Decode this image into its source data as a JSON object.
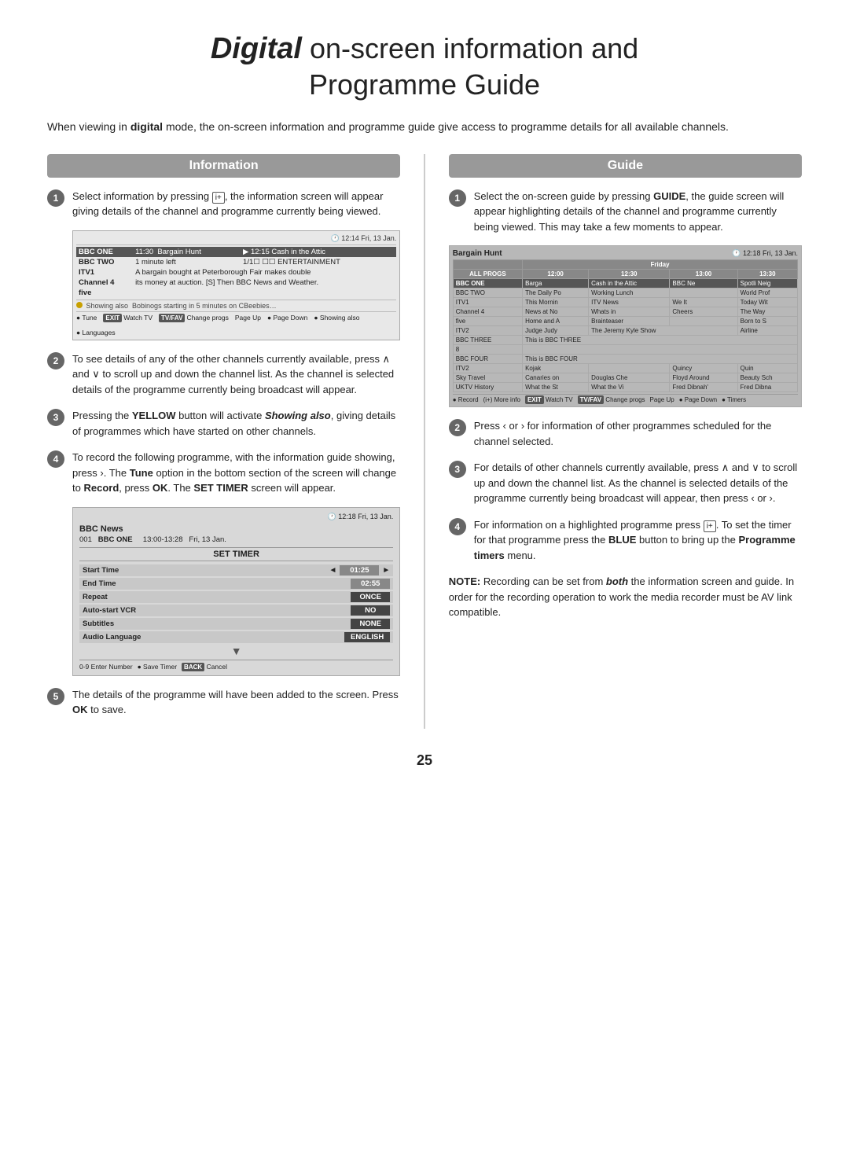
{
  "page": {
    "title_bold": "Digital",
    "title_rest": " on-screen information and",
    "title_line2": "Programme Guide",
    "intro": "When viewing in digital mode, the on-screen information and programme guide give access to programme details for all available channels.",
    "page_number": "25"
  },
  "info_section": {
    "header": "Information",
    "steps": [
      {
        "num": "1",
        "text": "Select information by pressing i+, the information screen will appear giving details of the channel and programme currently being viewed."
      },
      {
        "num": "2",
        "text": "To see details of any of the other channels currently available, press ∧ and ∨ to scroll up and down the channel list. As the channel is selected details of the programme currently being broadcast will appear."
      },
      {
        "num": "3",
        "text": "Pressing the YELLOW button will activate Showing also, giving details of programmes which have started on other channels."
      },
      {
        "num": "4",
        "text": "To record the following programme, with the information guide showing, press ›. The Tune option in the bottom section of the screen will change to Record, press OK. The SET TIMER screen will appear."
      },
      {
        "num": "5",
        "text": "The details of the programme will have been added to the screen. Press OK to save."
      }
    ]
  },
  "guide_section": {
    "header": "Guide",
    "steps": [
      {
        "num": "1",
        "text": "Select the on-screen guide by pressing GUIDE, the guide screen will appear highlighting details of the channel and programme currently being viewed. This may take a few moments to appear."
      },
      {
        "num": "2",
        "text": "Press ‹ or › for information of other programmes scheduled for the channel selected."
      },
      {
        "num": "3",
        "text": "For details of other channels currently available, press ∧ and ∨ to scroll up and down the channel list. As the channel is selected details of the programme currently being broadcast will appear, then press ‹ or ›."
      },
      {
        "num": "4",
        "text": "For information on a highlighted programme press i+. To set the timer for that programme press the BLUE button to bring up the Programme timers menu."
      }
    ],
    "note": "NOTE: Recording can be set from both the information screen and guide. In order for the recording operation to work the media recorder must be AV link compatible."
  },
  "info_screen": {
    "time": "🕐 12:14 Fri, 13 Jan.",
    "channels": [
      {
        "name": "BBC ONE",
        "col1": "11:30  Bargain Hunt",
        "col2": "▶ 12:15 Cash in the Attic",
        "highlight": true
      },
      {
        "name": "BBC TWO",
        "col1": "1 minute left",
        "col2": "1/1☐ ☐☐ ENTERTAINMENT",
        "highlight": false
      },
      {
        "name": "ITV1",
        "col1": "A bargain bought at Peterborough Fair makes double",
        "col2": "",
        "highlight": false
      },
      {
        "name": "Channel 4",
        "col1": "its money at auction. [S] Then BBC News and Weather.",
        "col2": "",
        "highlight": false
      },
      {
        "name": "five",
        "col1": "",
        "col2": "",
        "highlight": false
      }
    ],
    "showing_also": "Showing also  Bobinogs starting in 5 minutes on CBeebies…",
    "bottom_items": [
      "● Tune",
      "EXIT Watch TV",
      "TV/FAV Change progs",
      "Page Up",
      "● Page Down",
      "● Showing also",
      "● Languages"
    ]
  },
  "timer_screen": {
    "time": "🕐 12:18 Fri, 13 Jan.",
    "title": "BBC News",
    "info": "001   BBC ONE      13:00-13:28   Fri, 13 Jan.",
    "set_timer_label": "SET TIMER",
    "rows": [
      {
        "label": "Start Time",
        "value": "01:25",
        "dark": false
      },
      {
        "label": "End Time",
        "value": "02:55",
        "dark": false
      },
      {
        "label": "Repeat",
        "value": "ONCE",
        "dark": true
      },
      {
        "label": "Auto-start VCR",
        "value": "NO",
        "dark": true
      },
      {
        "label": "Subtitles",
        "value": "NONE",
        "dark": true
      },
      {
        "label": "Audio Language",
        "value": "ENGLISH",
        "dark": true
      }
    ],
    "bottom": "0-9 Enter Number  ● Save Timer  BACK Cancel"
  },
  "guide_screen": {
    "title": "Bargain Hunt",
    "time": "🕐 12:18 Fri, 13 Jan.",
    "col_header": "Friday",
    "cols": [
      "ALL PROGS",
      "12:00",
      "12:30",
      "13:00",
      "13:30"
    ],
    "rows": [
      {
        "channel": "BBC ONE",
        "cells": [
          "Barga",
          "Cash in the Attic",
          "BBC Ne",
          "Spotli",
          "Neig"
        ],
        "highlight": true
      },
      {
        "channel": "BBC TWO",
        "cells": [
          "The Daily Po",
          "Working Lunch",
          "",
          "World Prof"
        ],
        "highlight": false
      },
      {
        "channel": "ITV1",
        "cells": [
          "This Mornin",
          "ITV News",
          "",
          "We It",
          "Today Wit"
        ],
        "highlight": false
      },
      {
        "channel": "Channel 4",
        "cells": [
          "News at No",
          "Whats in",
          "Cheers",
          "",
          "The Way"
        ],
        "highlight": false
      },
      {
        "channel": "five",
        "cells": [
          "Home and A",
          "Brainteaser",
          "",
          "",
          "Born to S"
        ],
        "highlight": false
      },
      {
        "channel": "ITV2",
        "cells": [
          "Judge Judy",
          "The Jeremy Kyle Show",
          "",
          "Airline"
        ],
        "highlight": false
      },
      {
        "channel": "BBC THREE",
        "cells": [
          "This is BBC THREE"
        ],
        "highlight": false
      },
      {
        "channel": "8",
        "cells": [],
        "highlight": false
      },
      {
        "channel": "BBC FOUR",
        "cells": [
          "This is BBC FOUR"
        ],
        "highlight": false
      },
      {
        "channel": "ITV2",
        "cells": [
          "Kojak",
          "",
          "Quincy",
          "",
          "Quin"
        ],
        "highlight": false
      },
      {
        "channel": "Sky Travel",
        "cells": [
          "Canaries on",
          "Douglas Che",
          "Floyd Around",
          "Beauty Sch"
        ],
        "highlight": false
      },
      {
        "channel": "UKTV History",
        "cells": [
          "What the St",
          "What the Vi",
          "",
          "Fred Dibnah'",
          "Fred Dibna"
        ],
        "highlight": false
      }
    ],
    "bottom": "● Record  (i+) More info  EXIT Watch TV  TV/FAV Change progs  Page Up  ● Page Down  ● Timers"
  }
}
